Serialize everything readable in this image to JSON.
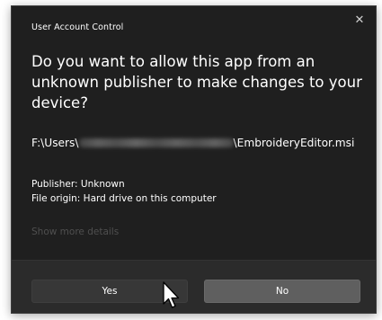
{
  "dialog": {
    "title": "User Account Control",
    "close_symbol": "✕",
    "question": "Do you want to allow this app from an unknown publisher to make changes to your device?",
    "path_prefix": "F:\\Users\\",
    "path_suffix": "\\EmbroideryEditor.msi",
    "publisher": "Publisher: Unknown",
    "file_origin": "File origin: Hard drive on this computer",
    "show_more": "Show more details",
    "yes_label": "Yes",
    "no_label": "No"
  },
  "icons": {
    "close": "close-icon",
    "cursor": "mouse-pointer-icon"
  },
  "colors": {
    "dialog_bg": "#1f1f1f",
    "footer_bg": "#2b2b2b",
    "yes_bg": "#373737",
    "no_bg": "#5f5f5f",
    "muted_text": "#4f4f4f"
  }
}
